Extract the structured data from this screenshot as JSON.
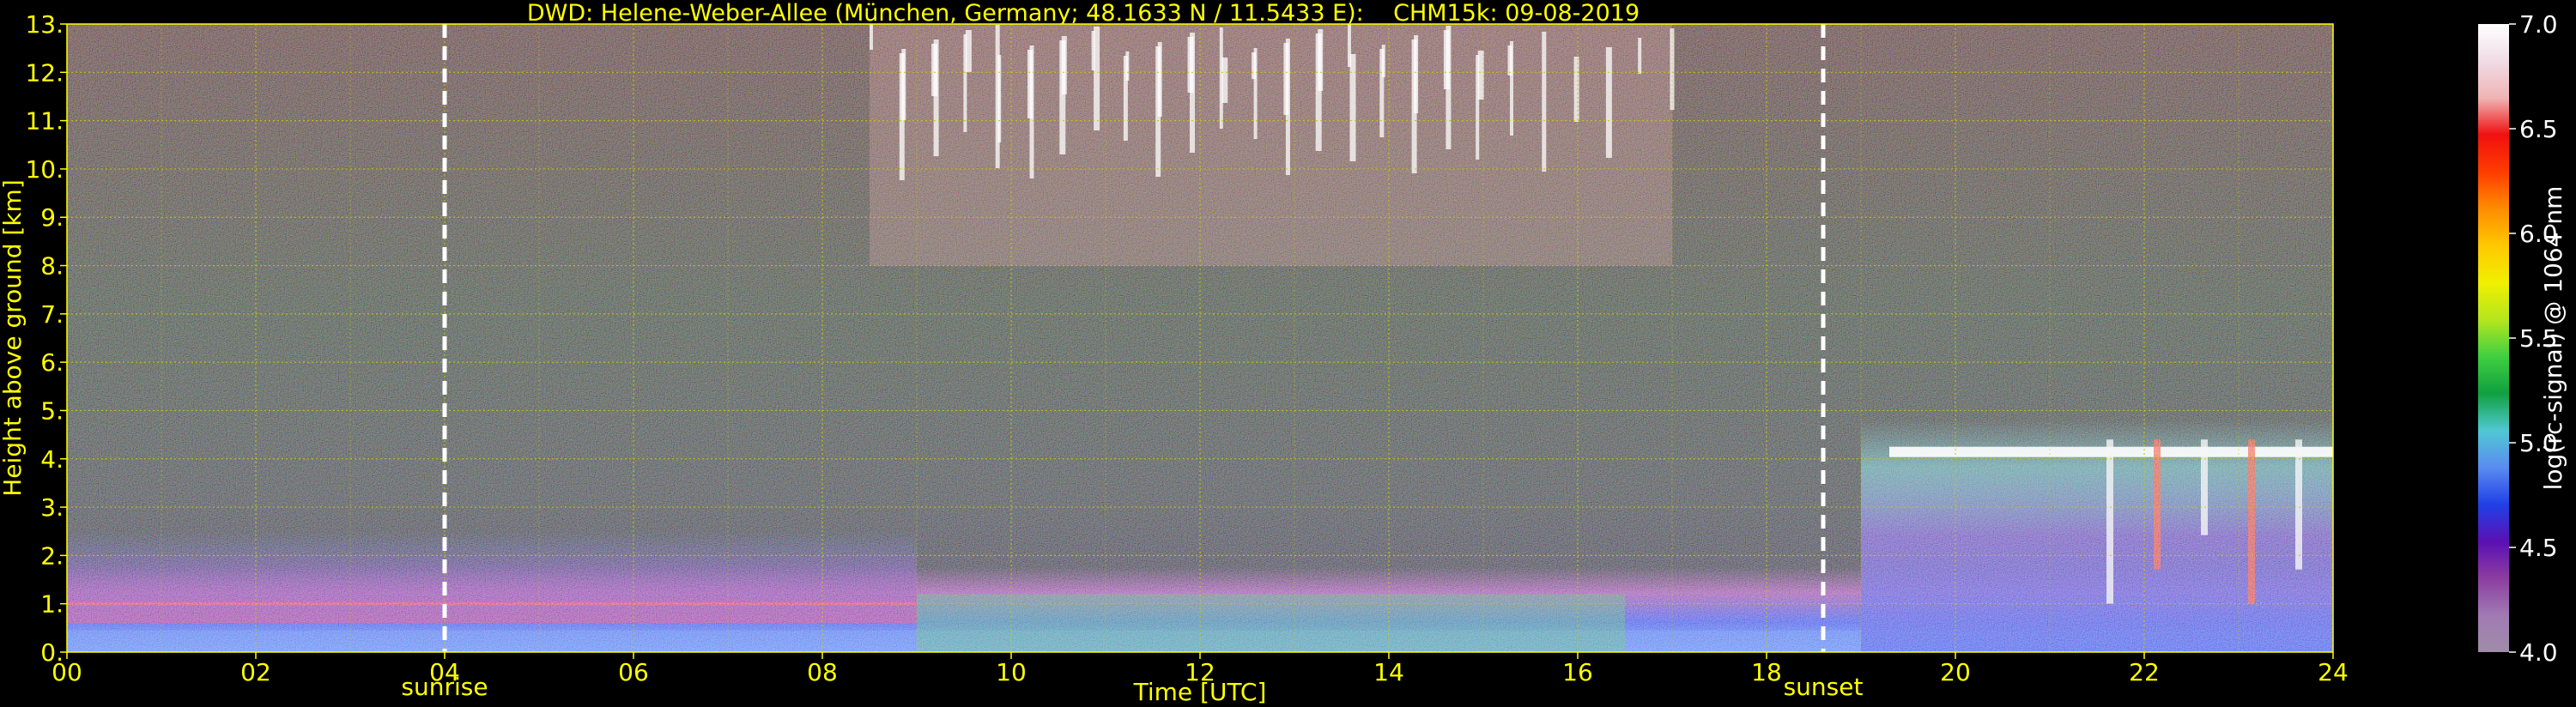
{
  "chart_data": {
    "type": "heatmap",
    "title": "DWD: Helene-Weber-Allee (München, Germany; 48.1633 N / 11.5433 E):    CHM15k: 09-08-2019",
    "xlabel": "Time [UTC]",
    "ylabel": "Height above ground [km]",
    "xlim": [
      0,
      24
    ],
    "ylim": [
      0,
      13
    ],
    "x_ticks": [
      0,
      2,
      4,
      6,
      8,
      10,
      12,
      14,
      16,
      18,
      20,
      22,
      24
    ],
    "x_tick_labels": [
      "00",
      "02",
      "04",
      "06",
      "08",
      "10",
      "12",
      "14",
      "16",
      "18",
      "20",
      "22",
      "24"
    ],
    "y_ticks": [
      0,
      1,
      2,
      3,
      4,
      5,
      6,
      7,
      8,
      9,
      10,
      11,
      12,
      13
    ],
    "y_tick_labels": [
      "0.",
      "1.",
      "2.",
      "3.",
      "4.",
      "5.",
      "6.",
      "7.",
      "8.",
      "9.",
      "10.",
      "11.",
      "12.",
      "13."
    ],
    "grid": true,
    "annotations": [
      {
        "label": "sunrise",
        "x": 4.0
      },
      {
        "label": "sunset",
        "x": 18.6
      }
    ],
    "colorbar": {
      "label": "log(rc-signal) @ 1064 nm",
      "range": [
        4.0,
        7.0
      ],
      "ticks": [
        4.0,
        4.5,
        5.0,
        5.5,
        6.0,
        6.5,
        7.0
      ],
      "tick_labels": [
        "4.0",
        "4.5",
        "5.0",
        "5.5",
        "6.0",
        "6.5",
        "7.0"
      ],
      "colors": [
        "#a08ca8",
        "#a07ab4",
        "#8c3ca0",
        "#5a10b4",
        "#2040e6",
        "#5a8cf0",
        "#50c8d2",
        "#10a040",
        "#40d040",
        "#b4e61e",
        "#f0f000",
        "#ffc800",
        "#ff8c00",
        "#ff3c00",
        "#f01010",
        "#f0b4b4",
        "#f0dce6",
        "#ffffff"
      ]
    },
    "layers": [
      {
        "name": "boundary-layer",
        "x": [
          0,
          24
        ],
        "top_km": 1.1,
        "value": 5.0
      },
      {
        "name": "residual-layer",
        "x": [
          0,
          9
        ],
        "top_km": 2.5,
        "value": 4.6
      },
      {
        "name": "cirrus",
        "x": [
          8.5,
          17
        ],
        "base_km": 8,
        "top_km": 13,
        "value": 6.5
      },
      {
        "name": "evening-cloud",
        "x": [
          19,
          24
        ],
        "base_km": 3,
        "top_km": 4.8,
        "value": 6.2
      }
    ]
  },
  "colors": {
    "text": "#ffff00",
    "background": "#000000",
    "grid": "#c8c800",
    "annotation_line": "#ffffff"
  }
}
